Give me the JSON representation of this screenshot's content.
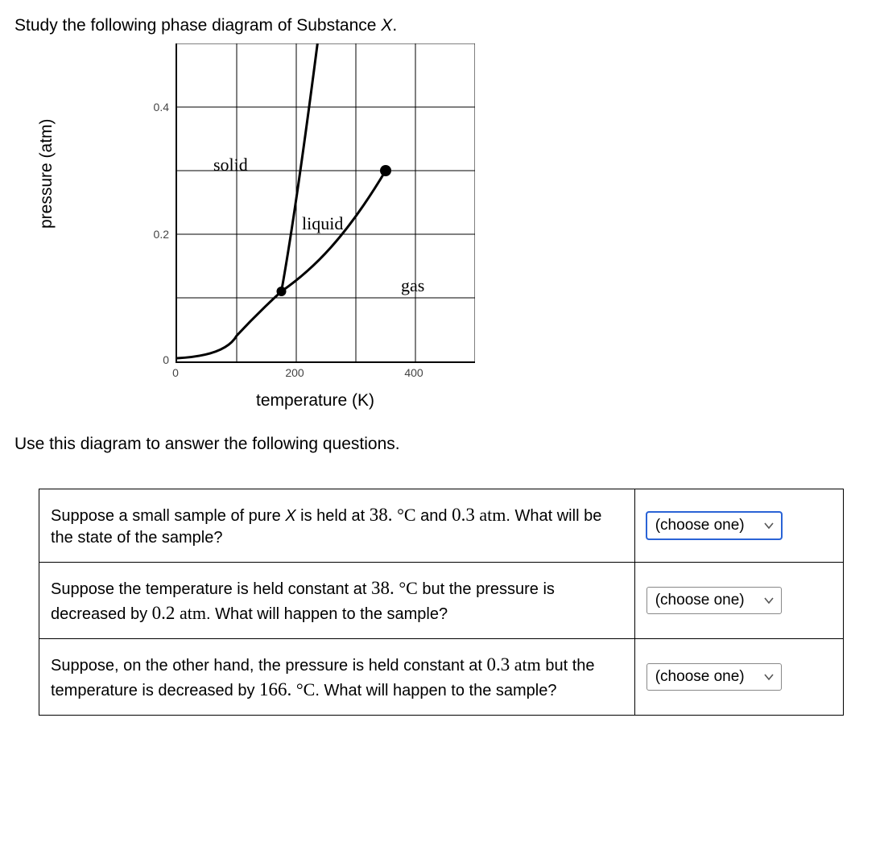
{
  "intro_prefix": "Study the following phase diagram of Substance ",
  "intro_subject": "X",
  "intro_suffix": ".",
  "mid_text": "Use this diagram to answer the following questions.",
  "chart_data": {
    "type": "line",
    "title": "",
    "xlabel": "temperature (K)",
    "ylabel": "pressure (atm)",
    "xlim": [
      0,
      500
    ],
    "ylim": [
      0,
      0.5
    ],
    "xticks": [
      0,
      200,
      400
    ],
    "yticks": [
      0,
      0.2,
      0.4
    ],
    "regions": {
      "solid": {
        "label": "solid"
      },
      "liquid": {
        "label": "liquid"
      },
      "gas": {
        "label": "gas"
      }
    },
    "triple_point": {
      "T": 175,
      "P": 0.11
    },
    "critical_point": {
      "T": 350,
      "P": 0.3
    },
    "series": [
      {
        "name": "solid-gas",
        "x": [
          0,
          50,
          100,
          150,
          175
        ],
        "y": [
          0.005,
          0.015,
          0.04,
          0.08,
          0.11
        ]
      },
      {
        "name": "liquid-gas",
        "x": [
          175,
          220,
          270,
          320,
          350
        ],
        "y": [
          0.11,
          0.14,
          0.19,
          0.25,
          0.3
        ]
      },
      {
        "name": "solid-liquid",
        "x": [
          175,
          185,
          200,
          215,
          232
        ],
        "y": [
          0.11,
          0.2,
          0.32,
          0.44,
          0.56
        ]
      }
    ]
  },
  "questions": [
    {
      "parts": [
        {
          "t": "plain",
          "v": "Suppose a small sample of pure "
        },
        {
          "t": "ital",
          "v": "X"
        },
        {
          "t": "plain",
          "v": " is held at "
        },
        {
          "t": "num",
          "v": "38."
        },
        {
          "t": "plain",
          "v": " "
        },
        {
          "t": "deg",
          "v": "°C"
        },
        {
          "t": "plain",
          "v": " and "
        },
        {
          "t": "num",
          "v": "0.3"
        },
        {
          "t": "plain",
          "v": " "
        },
        {
          "t": "unit",
          "v": "atm"
        },
        {
          "t": "small",
          "v": ". What will be the state of the sample?"
        }
      ],
      "dropdown": {
        "label": "(choose one)",
        "focused": true
      }
    },
    {
      "parts": [
        {
          "t": "plain",
          "v": "Suppose the temperature is held constant at "
        },
        {
          "t": "num",
          "v": "38."
        },
        {
          "t": "plain",
          "v": " "
        },
        {
          "t": "deg",
          "v": "°C"
        },
        {
          "t": "small",
          "v": " but the pressure is decreased by "
        },
        {
          "t": "num",
          "v": "0.2"
        },
        {
          "t": "plain",
          "v": " "
        },
        {
          "t": "unit",
          "v": "atm"
        },
        {
          "t": "small",
          "v": ". What will happen to the sample?"
        }
      ],
      "dropdown": {
        "label": "(choose one)",
        "focused": false
      }
    },
    {
      "parts": [
        {
          "t": "plain",
          "v": "Suppose, on the other hand, the pressure is held constant at "
        },
        {
          "t": "num",
          "v": "0.3"
        },
        {
          "t": "plain",
          "v": " "
        },
        {
          "t": "unit",
          "v": "atm"
        },
        {
          "t": "small",
          "v": " but the temperature is decreased by "
        },
        {
          "t": "num",
          "v": "166."
        },
        {
          "t": "plain",
          "v": " "
        },
        {
          "t": "deg",
          "v": "°C"
        },
        {
          "t": "small",
          "v": ". What will happen to the sample?"
        }
      ],
      "dropdown": {
        "label": "(choose one)",
        "focused": false
      }
    }
  ]
}
